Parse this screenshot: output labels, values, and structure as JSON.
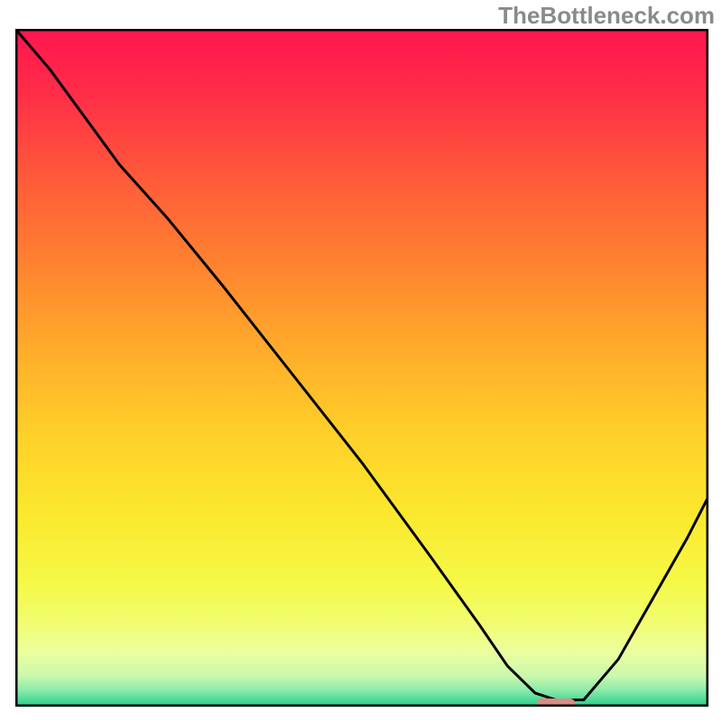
{
  "watermark": "TheBottleneck.com",
  "chart_data": {
    "type": "line",
    "title": "",
    "xlabel": "",
    "ylabel": "",
    "xlim": [
      0,
      100
    ],
    "ylim": [
      0,
      100
    ],
    "grid": false,
    "series": [
      {
        "name": "bottleneck-curve",
        "color": "#000000",
        "x": [
          0,
          5,
          10,
          15,
          22,
          30,
          40,
          50,
          60,
          67,
          71,
          75,
          78,
          82,
          87,
          92,
          97,
          100
        ],
        "y": [
          100,
          94,
          87,
          80,
          72,
          62,
          49,
          36,
          22,
          12,
          6,
          2,
          1,
          1,
          7,
          16,
          25,
          31
        ]
      }
    ],
    "markers": [
      {
        "name": "optimal-marker",
        "shape": "rounded-rect",
        "color": "#d98b85",
        "x": 78,
        "y": 0.5,
        "width_pct": 5.5,
        "height_pct": 1.4
      }
    ],
    "background": {
      "type": "vertical-gradient",
      "stops": [
        {
          "offset": 0.0,
          "color": "#ff154f"
        },
        {
          "offset": 0.1,
          "color": "#ff2f47"
        },
        {
          "offset": 0.22,
          "color": "#ff5a3a"
        },
        {
          "offset": 0.35,
          "color": "#ff8330"
        },
        {
          "offset": 0.48,
          "color": "#ffae2a"
        },
        {
          "offset": 0.6,
          "color": "#ffd029"
        },
        {
          "offset": 0.72,
          "color": "#fbe92e"
        },
        {
          "offset": 0.82,
          "color": "#f5f948"
        },
        {
          "offset": 0.88,
          "color": "#f1fd73"
        },
        {
          "offset": 0.92,
          "color": "#ecfea0"
        },
        {
          "offset": 0.955,
          "color": "#c9f8ac"
        },
        {
          "offset": 0.975,
          "color": "#8eebaa"
        },
        {
          "offset": 0.99,
          "color": "#4ed997"
        },
        {
          "offset": 1.0,
          "color": "#25cc86"
        }
      ]
    }
  }
}
